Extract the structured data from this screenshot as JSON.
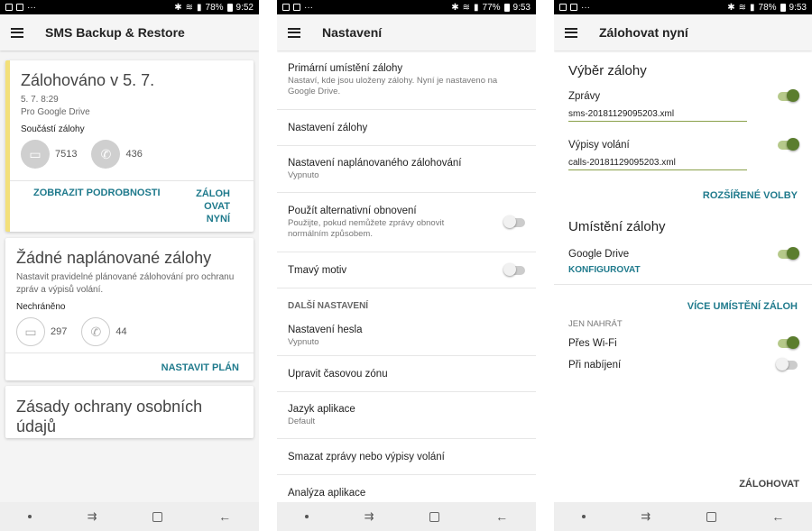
{
  "status_bars": [
    {
      "battery": "78%",
      "time": "9:52"
    },
    {
      "battery": "77%",
      "time": "9:53"
    },
    {
      "battery": "78%",
      "time": "9:53"
    }
  ],
  "screen1": {
    "title": "SMS Backup & Restore",
    "card_backed": {
      "title": "Zálohováno v 5. 7.",
      "time": "5. 7. 8:29",
      "dest": "Pro Google Drive",
      "label": "Součástí zálohy",
      "messages_count": "7513",
      "calls_count": "436",
      "details_button": "ZOBRAZIT PODROBNOSTI",
      "backup_now_button": "ZÁLOH OVAT NYNÍ"
    },
    "card_schedule": {
      "title": "Žádné naplánované zálohy",
      "desc": "Nastavit pravidelné plánované zálohování pro ochranu zpráv a výpisů volání.",
      "label": "Nechráněno",
      "messages_count": "297",
      "calls_count": "44",
      "button": "NASTAVIT PLÁN"
    },
    "card_privacy": {
      "title": "Zásady ochrany osobních údajů"
    }
  },
  "screen2": {
    "title": "Nastavení",
    "items": [
      {
        "title": "Primární umístění zálohy",
        "sub": "Nastaví, kde jsou uloženy zálohy. Nyní je nastaveno na Google Drive."
      },
      {
        "title": "Nastavení zálohy",
        "sub": ""
      },
      {
        "title": "Nastavení naplánovaného zálohování",
        "sub": "Vypnuto"
      },
      {
        "title": "Použít alternativní obnovení",
        "sub": "Použijte, pokud nemůžete zprávy obnovit normálním způsobem."
      },
      {
        "title": "Tmavý motiv",
        "sub": ""
      }
    ],
    "section": "DALŠÍ NASTAVENÍ",
    "items2": [
      {
        "title": "Nastavení hesla",
        "sub": "Vypnuto"
      },
      {
        "title": "Upravit časovou zónu",
        "sub": ""
      },
      {
        "title": "Jazyk aplikace",
        "sub": "Default"
      },
      {
        "title": "Smazat zprávy nebo výpisy volání",
        "sub": ""
      },
      {
        "title": "Analýza aplikace",
        "sub": ""
      }
    ]
  },
  "screen3": {
    "title": "Zálohovat nyní",
    "select_heading": "Výběr zálohy",
    "messages_label": "Zprávy",
    "messages_file": "sms-20181129095203.xml",
    "calls_label": "Výpisy volání",
    "calls_file": "calls-20181129095203.xml",
    "advanced": "ROZŠÍŘENÉ VOLBY",
    "location_heading": "Umístění zálohy",
    "drive_label": "Google Drive",
    "configure": "KONFIGUROVAT",
    "more_locations": "VÍCE UMÍSTĚNÍ ZÁLOH",
    "upload_only": "JEN NAHRÁT",
    "wifi": "Přes Wi-Fi",
    "charging": "Při nabíjení",
    "backup_button": "ZÁLOHOVAT"
  },
  "colors": {
    "accent": "#1f7a8c",
    "switch_on": "#5b7d2e",
    "card_highlight": "#f3e07a"
  }
}
